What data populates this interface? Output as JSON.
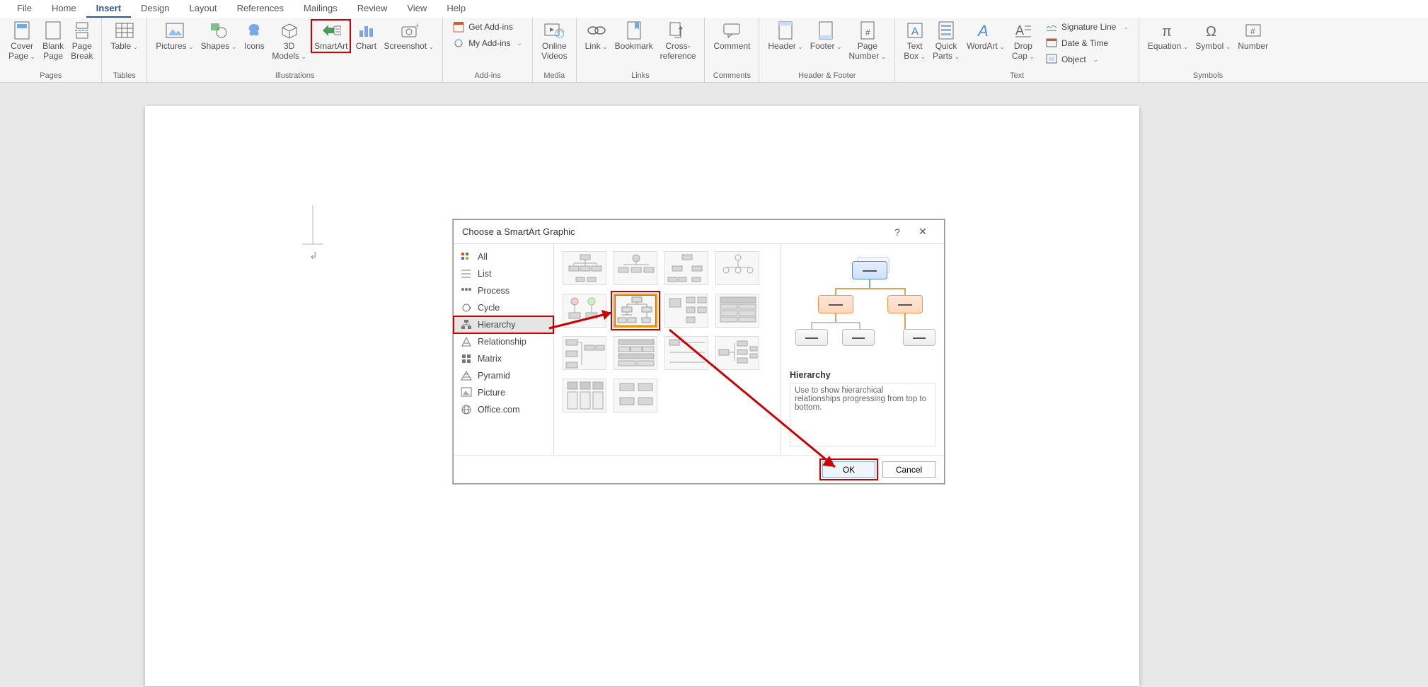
{
  "tabs": {
    "file": "File",
    "home": "Home",
    "insert": "Insert",
    "design": "Design",
    "layout": "Layout",
    "references": "References",
    "mailings": "Mailings",
    "review": "Review",
    "view": "View",
    "help": "Help",
    "active": "Insert"
  },
  "groups": {
    "pages": "Pages",
    "tables": "Tables",
    "illustrations": "Illustrations",
    "addins": "Add-ins",
    "media": "Media",
    "links": "Links",
    "comments": "Comments",
    "headerfooter": "Header & Footer",
    "text": "Text",
    "symbols": "Symbols"
  },
  "btn": {
    "cover": "Cover\nPage",
    "blank": "Blank\nPage",
    "pagebreak": "Page\nBreak",
    "table": "Table",
    "pictures": "Pictures",
    "shapes": "Shapes",
    "icons": "Icons",
    "models": "3D\nModels",
    "smartart": "SmartArt",
    "chart": "Chart",
    "screenshot": "Screenshot",
    "getaddins": "Get Add-ins",
    "myaddins": "My Add-ins",
    "onlinevid": "Online\nVideos",
    "link": "Link",
    "bookmark": "Bookmark",
    "crossref": "Cross-\nreference",
    "comment": "Comment",
    "header": "Header",
    "footer": "Footer",
    "pagenum": "Page\nNumber",
    "textbox": "Text\nBox",
    "quickparts": "Quick\nParts",
    "wordart": "WordArt",
    "dropcap": "Drop\nCap",
    "sigline": "Signature Line",
    "datetime": "Date & Time",
    "object": "Object",
    "equation": "Equation",
    "symbolbtn": "Symbol",
    "number": "Number"
  },
  "dialog": {
    "title": "Choose a SmartArt Graphic",
    "cats": [
      "All",
      "List",
      "Process",
      "Cycle",
      "Hierarchy",
      "Relationship",
      "Matrix",
      "Pyramid",
      "Picture",
      "Office.com"
    ],
    "selected": "Hierarchy",
    "preview_title": "Hierarchy",
    "preview_desc": "Use to show hierarchical relationships progressing from top to bottom.",
    "ok": "OK",
    "cancel": "Cancel"
  }
}
